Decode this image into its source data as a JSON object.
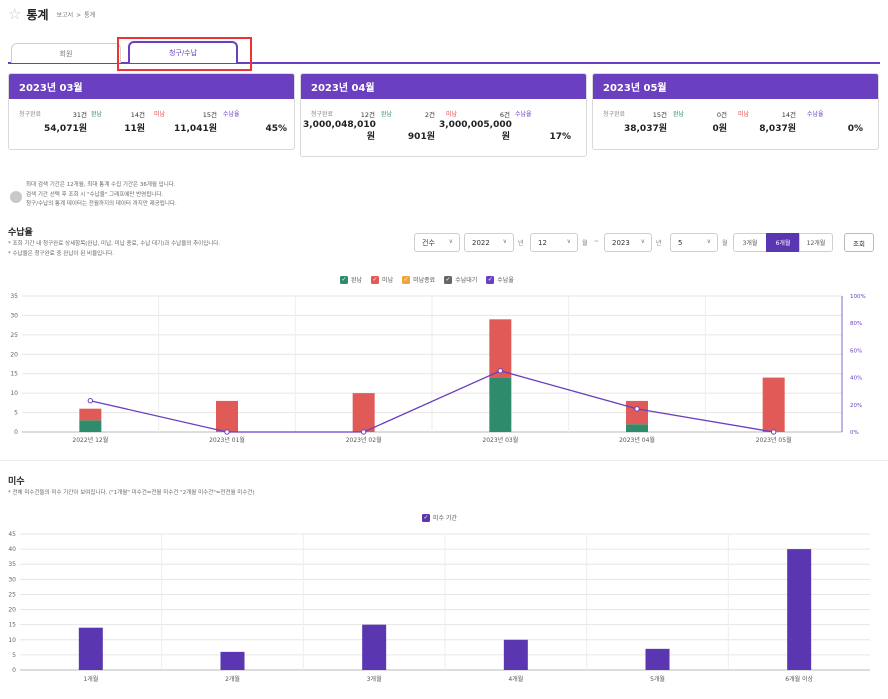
{
  "header": {
    "title": "통계",
    "breadcrumb": [
      "보고서",
      "통계"
    ]
  },
  "tabs": [
    {
      "label": "회원"
    },
    {
      "label": "청구/수납"
    }
  ],
  "cards": [
    {
      "title": "2023년 03월",
      "claim_label": "청구완료",
      "claim_count": "31건",
      "claim_amount": "54,071원",
      "paid_label": "완납",
      "paid_count": "14건",
      "paid_amount": "11원",
      "unpaid_label": "미납",
      "unpaid_count": "15건",
      "unpaid_amount": "11,041원",
      "rate_label": "수납율",
      "rate": "45%"
    },
    {
      "title": "2023년 04월",
      "claim_label": "청구완료",
      "claim_count": "12건",
      "claim_amount": "3,000,048,010",
      "claim_amount_unit": "원",
      "paid_label": "완납",
      "paid_count": "2건",
      "paid_amount": "901원",
      "unpaid_label": "미납",
      "unpaid_count": "6건",
      "unpaid_amount": "3,000,005,000",
      "unpaid_amount_unit": "원",
      "rate_label": "수납율",
      "rate": "17%"
    },
    {
      "title": "2023년 05월",
      "claim_label": "청구완료",
      "claim_count": "15건",
      "claim_amount": "38,037원",
      "paid_label": "완납",
      "paid_count": "0건",
      "paid_amount": "0원",
      "unpaid_label": "미납",
      "unpaid_count": "14건",
      "unpaid_amount": "8,037원",
      "rate_label": "수납율",
      "rate": "0%"
    }
  ],
  "notes": [
    "최대 검색 기간은 12개월, 최대 통계 수집 기간은 36개월 입니다.",
    "검색 기간 선택 후 조회 시 \"수납율\" 그래프에만 반영됩니다.",
    "청구/수납의 통계 데이터는 전월까지의 데이터 까지만 제공됩니다."
  ],
  "section1": {
    "title": "수납율",
    "desc": [
      "* 조회 기간 내 청구완료 상세항목(완납, 미납, 미납 종료, 수납 대기)과 수납율의 추이입니다.",
      "* 수납율은 청구완료 중 완납이 된 비율입니다."
    ]
  },
  "controls": {
    "type": "건수",
    "start_year": "2022",
    "year_unit1": "년",
    "start_month": "12",
    "month_unit1": "월",
    "tilde": "~",
    "end_year": "2023",
    "year_unit2": "년",
    "end_month": "5",
    "month_unit2": "월",
    "ranges": [
      "3개월",
      "6개월",
      "12개월"
    ],
    "active_range": "6개월",
    "search": "조회"
  },
  "legend1": [
    {
      "label": "완납",
      "color": "#2e8b6b"
    },
    {
      "label": "미납",
      "color": "#e05a57"
    },
    {
      "label": "미납종료",
      "color": "#f0a43a"
    },
    {
      "label": "수납대기",
      "color": "#666666"
    },
    {
      "label": "수납율",
      "color": "#6a3fc0"
    }
  ],
  "section2": {
    "title": "미수",
    "desc": "* 전체 미수건들의 미수 기간이 보여집니다. (\"1개월\" 미수건=전월 미수건 \"2개월 미수건\"=전전월 미수건)"
  },
  "legend2": [
    {
      "label": "미수 기간",
      "color": "#5a36b0"
    }
  ],
  "chart_data": [
    {
      "type": "bar",
      "categories": [
        "2022년 12월",
        "2023년 01월",
        "2023년 02월",
        "2023년 03월",
        "2023년 04월",
        "2023년 05월"
      ],
      "series": [
        {
          "name": "완납",
          "values": [
            3,
            0,
            0,
            14,
            2,
            0
          ]
        },
        {
          "name": "미납",
          "values": [
            3,
            8,
            10,
            15,
            6,
            14
          ]
        },
        {
          "name": "미납종료",
          "values": [
            0,
            0,
            0,
            0,
            0,
            0
          ]
        },
        {
          "name": "수납대기",
          "values": [
            0,
            0,
            0,
            0,
            0,
            0
          ]
        },
        {
          "name": "수납율",
          "values": [
            23,
            0,
            0,
            45,
            17,
            0
          ]
        }
      ],
      "stacked": true,
      "ylim": [
        0,
        35
      ],
      "yticks": [
        0,
        5,
        10,
        15,
        20,
        25,
        30,
        35
      ],
      "y2lim": [
        0,
        100
      ],
      "y2ticks": [
        "0%",
        "20%",
        "40%",
        "60%",
        "80%",
        "100%"
      ],
      "grid": true,
      "legend": "top-center"
    },
    {
      "type": "bar",
      "categories": [
        "1개월",
        "2개월",
        "3개월",
        "4개월",
        "5개월",
        "6개월 이상"
      ],
      "series": [
        {
          "name": "미수 기간",
          "values": [
            14,
            6,
            15,
            10,
            7,
            40
          ]
        }
      ],
      "ylim": [
        0,
        45
      ],
      "yticks": [
        0,
        5,
        10,
        15,
        20,
        25,
        30,
        35,
        40,
        45
      ],
      "grid": true,
      "legend": "top-center"
    }
  ]
}
